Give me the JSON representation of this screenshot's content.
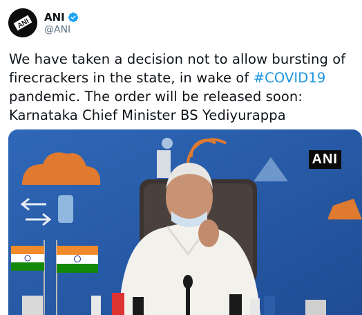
{
  "author": {
    "display_name": "ANI",
    "handle": "@ANI",
    "avatar_icon": "ani-logo-icon",
    "verified_icon": "verified-badge-icon"
  },
  "tweet": {
    "text_1": "We have taken a decision not to allow bursting of firecrackers in the state, in wake of ",
    "hashtag": "#COVID19",
    "text_2": " pandemic. The order will be released soon: Karnataka Chief Minister BS Yediyurappa"
  },
  "media": {
    "watermark": "ANI"
  },
  "colors": {
    "hashtag": "#1b95e0",
    "handle": "#5b7083",
    "verified": "#1da1f2",
    "media_background": "#2a5aa8"
  }
}
